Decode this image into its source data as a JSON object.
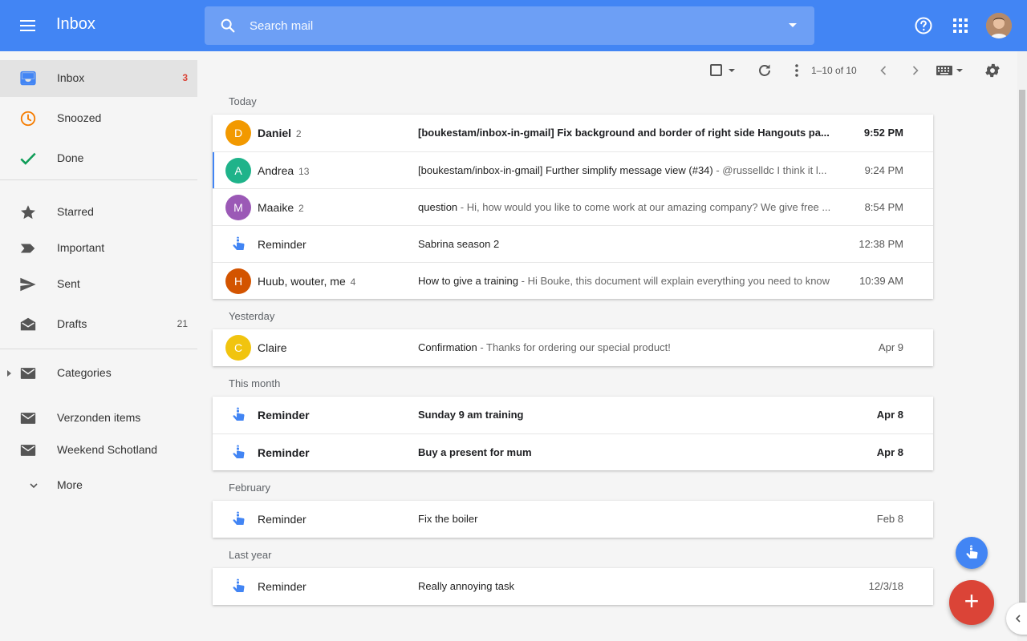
{
  "header": {
    "title": "Inbox",
    "search_placeholder": "Search mail"
  },
  "colors": {
    "topbar": "#4285f4",
    "compose_fab": "#db4437",
    "unread_badge": "#db4437"
  },
  "sidebar": {
    "items": [
      {
        "label": "Inbox",
        "count": "3",
        "icon": "inbox-icon",
        "active": true
      },
      {
        "label": "Snoozed",
        "count": "",
        "icon": "clock-icon"
      },
      {
        "label": "Done",
        "count": "",
        "icon": "check-icon"
      },
      {
        "label": "Starred",
        "count": "",
        "icon": "star-icon"
      },
      {
        "label": "Important",
        "count": "",
        "icon": "important-icon"
      },
      {
        "label": "Sent",
        "count": "",
        "icon": "send-icon"
      },
      {
        "label": "Drafts",
        "count": "21",
        "icon": "draft-icon"
      },
      {
        "label": "Categories",
        "count": "",
        "icon": "label-icon"
      },
      {
        "label": "Verzonden items",
        "count": "",
        "icon": "label-icon"
      },
      {
        "label": "Weekend Schotland",
        "count": "",
        "icon": "label-icon"
      },
      {
        "label": "More",
        "count": "",
        "icon": "chevron-down-icon"
      }
    ]
  },
  "toolbar": {
    "pager": "1–10 of 10"
  },
  "sections": [
    {
      "title": "Today",
      "rows": [
        {
          "avatar": "D",
          "avatar_color": "#f29900",
          "sender": "Daniel",
          "count": "2",
          "subject": "[boukestam/inbox-in-gmail] Fix background and border of right side Hangouts pa...",
          "snippet": "",
          "time": "9:52 PM",
          "unread": true
        },
        {
          "avatar": "A",
          "avatar_color": "#1fb38a",
          "sender": "Andrea",
          "count": "13",
          "subject": "[boukestam/inbox-in-gmail] Further simplify message view (#34)",
          "snippet": " - @russelldc I think it l...",
          "time": "9:24 PM",
          "unread": false,
          "selected": true
        },
        {
          "avatar": "M",
          "avatar_color": "#9b59b6",
          "sender": "Maaike",
          "count": "2",
          "subject": "question",
          "snippet": " - Hi, how would you like to come work at our amazing company? We give free ...",
          "time": "8:54 PM",
          "unread": false
        },
        {
          "avatar": "",
          "reminder": true,
          "sender": "Reminder",
          "count": "",
          "subject": "Sabrina season 2",
          "snippet": "",
          "time": "12:38 PM",
          "unread": false
        },
        {
          "avatar": "H",
          "avatar_color": "#d35400",
          "sender": "Huub, wouter, me",
          "count": "4",
          "subject": "How to give a training",
          "snippet": " - Hi Bouke, this document will explain everything you need to know",
          "time": "10:39 AM",
          "unread": false
        }
      ]
    },
    {
      "title": "Yesterday",
      "rows": [
        {
          "avatar": "C",
          "avatar_color": "#f1c40f",
          "sender": "Claire",
          "count": "",
          "subject": "Confirmation",
          "snippet": " - Thanks for ordering our special product!",
          "time": "Apr 9",
          "unread": false
        }
      ]
    },
    {
      "title": "This month",
      "rows": [
        {
          "avatar": "",
          "reminder": true,
          "sender": "Reminder",
          "count": "",
          "subject": "Sunday 9 am training",
          "snippet": "",
          "time": "Apr 8",
          "unread": true
        },
        {
          "avatar": "",
          "reminder": true,
          "sender": "Reminder",
          "count": "",
          "subject": "Buy a present for mum",
          "snippet": "",
          "time": "Apr 8",
          "unread": true
        }
      ]
    },
    {
      "title": "February",
      "rows": [
        {
          "avatar": "",
          "reminder": true,
          "sender": "Reminder",
          "count": "",
          "subject": "Fix the boiler",
          "snippet": "",
          "time": "Feb 8",
          "unread": false
        }
      ]
    },
    {
      "title": "Last year",
      "rows": [
        {
          "avatar": "",
          "reminder": true,
          "sender": "Reminder",
          "count": "",
          "subject": "Really annoying task",
          "snippet": "",
          "time": "12/3/18",
          "unread": false
        }
      ]
    }
  ],
  "fabs": {
    "compose_label": "+"
  }
}
